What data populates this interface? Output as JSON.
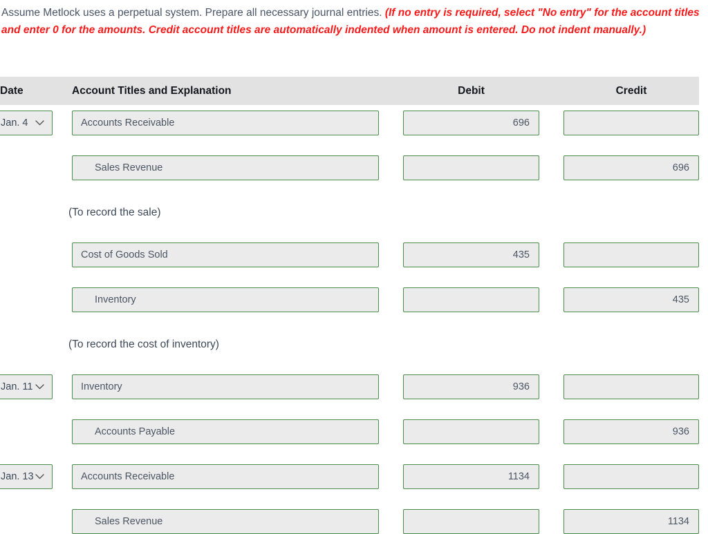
{
  "intro": {
    "normal_text": "Assume Metlock uses a perpetual system. Prepare all necessary journal entries. ",
    "hint_text": "(If no entry is required, select \"No entry\" for the account titles and enter 0 for the amounts. Credit account titles are automatically indented when amount is entered. Do not indent manually.)",
    "hint_color": "#f61b1b",
    "text_color": "#4a5568"
  },
  "table": {
    "header_bg": "#e2e2e2",
    "field_bg": "#ebebeb",
    "field_border": "#4a8c4a",
    "columns": {
      "date": "Date",
      "account": "Account Titles and Explanation",
      "debit": "Debit",
      "credit": "Credit"
    },
    "rows": [
      {
        "kind": "entry",
        "date": "Jan. 4",
        "account": "Accounts Receivable",
        "indent": false,
        "debit": "696",
        "credit": ""
      },
      {
        "kind": "entry",
        "date": "",
        "account": "Sales Revenue",
        "indent": true,
        "debit": "",
        "credit": "696"
      },
      {
        "kind": "explanation",
        "text": "(To record the sale)"
      },
      {
        "kind": "entry",
        "date": "",
        "account": "Cost of Goods Sold",
        "indent": false,
        "debit": "435",
        "credit": ""
      },
      {
        "kind": "entry",
        "date": "",
        "account": "Inventory",
        "indent": true,
        "debit": "",
        "credit": "435"
      },
      {
        "kind": "explanation",
        "text": "(To record the cost of inventory)"
      },
      {
        "kind": "entry",
        "date": "Jan. 11",
        "account": "Inventory",
        "indent": false,
        "debit": "936",
        "credit": ""
      },
      {
        "kind": "entry",
        "date": "",
        "account": "Accounts Payable",
        "indent": true,
        "debit": "",
        "credit": "936"
      },
      {
        "kind": "entry",
        "date": "Jan. 13",
        "account": "Accounts Receivable",
        "indent": false,
        "debit": "1134",
        "credit": ""
      },
      {
        "kind": "entry",
        "date": "",
        "account": "Sales Revenue",
        "indent": true,
        "debit": "",
        "credit": "1134"
      }
    ]
  }
}
